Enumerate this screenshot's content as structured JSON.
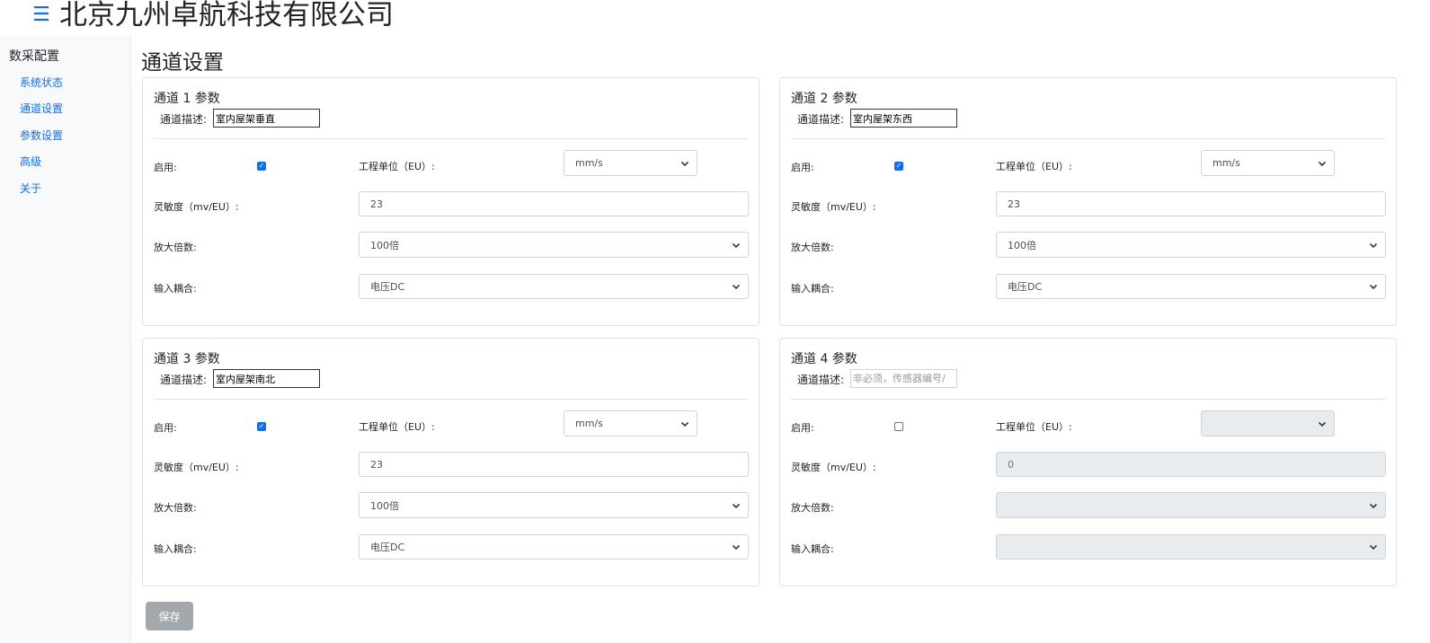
{
  "header": {
    "menu_icon": "hamburger-icon",
    "company": "北京九州卓航科技有限公司"
  },
  "sidebar": {
    "title": "数采配置",
    "items": [
      {
        "label": "系统状态"
      },
      {
        "label": "通道设置"
      },
      {
        "label": "参数设置"
      },
      {
        "label": "高级"
      },
      {
        "label": "关于"
      }
    ]
  },
  "page_title": "通道设置",
  "labels": {
    "desc": "通道描述:",
    "enable": "启用:",
    "eu": "工程单位（EU）:",
    "sensitivity": "灵敏度（mv/EU）:",
    "amplification": "放大倍数:",
    "coupling": "输入耦合:"
  },
  "channels": [
    {
      "title": "通道 1 参数",
      "desc_value": "室内屋架垂直",
      "desc_placeholder": "",
      "enabled": true,
      "unit": "mm/s",
      "sensitivity": "23",
      "amplification": "100倍",
      "coupling": "电压DC"
    },
    {
      "title": "通道 2 参数",
      "desc_value": "室内屋架东西",
      "desc_placeholder": "",
      "enabled": true,
      "unit": "mm/s",
      "sensitivity": "23",
      "amplification": "100倍",
      "coupling": "电压DC"
    },
    {
      "title": "通道 3 参数",
      "desc_value": "室内屋架南北",
      "desc_placeholder": "",
      "enabled": true,
      "unit": "mm/s",
      "sensitivity": "23",
      "amplification": "100倍",
      "coupling": "电压DC"
    },
    {
      "title": "通道 4 参数",
      "desc_value": "",
      "desc_placeholder": "非必须，传感器编号/",
      "enabled": false,
      "unit": "",
      "sensitivity": "0",
      "amplification": "",
      "coupling": ""
    }
  ],
  "save_label": "保存",
  "colors": {
    "accent": "#0d6efd",
    "disabled_bg": "#e9ecef",
    "save_button": "#a3a8ad"
  }
}
